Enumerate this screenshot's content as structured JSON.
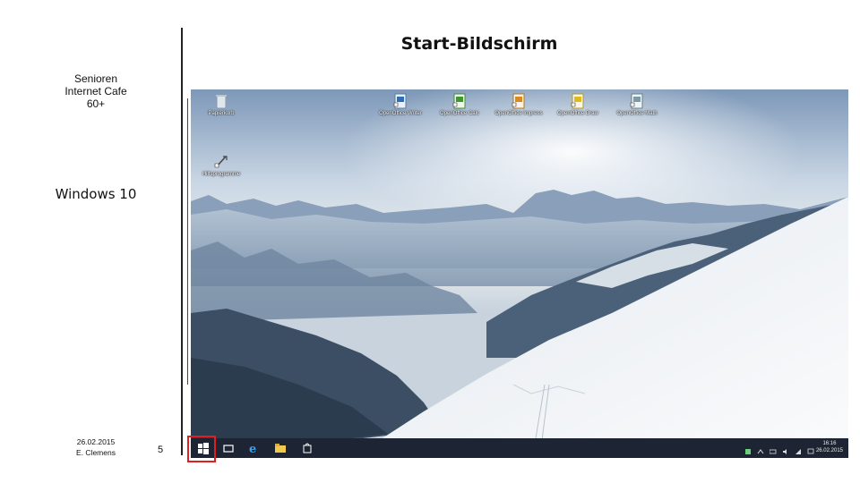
{
  "slide": {
    "title": "Start-Bildschirm",
    "org_lines": [
      "Senioren",
      "Internet Cafe",
      "60+"
    ],
    "subject": "Windows 10",
    "date": "26.02.2015",
    "author": "E. Clemens",
    "page": "5"
  },
  "desktop": {
    "icons": [
      {
        "label": "Papierkorb",
        "icon": "recycle-bin-icon"
      },
      {
        "label": "OpenOffice Writer",
        "icon": "openoffice-writer-icon"
      },
      {
        "label": "OpenOffice Calc",
        "icon": "openoffice-calc-icon"
      },
      {
        "label": "OpenOffice Impress",
        "icon": "openoffice-impress-icon"
      },
      {
        "label": "OpenOffice Draw",
        "icon": "openoffice-draw-icon"
      },
      {
        "label": "OpenOffice Math",
        "icon": "openoffice-math-icon"
      },
      {
        "label": "Hilfsprogramme",
        "icon": "shortcut-icon"
      }
    ],
    "taskbar": {
      "items": [
        "start-button",
        "task-view",
        "internet-explorer",
        "file-explorer",
        "store"
      ],
      "clock": {
        "time": "16:16",
        "date": "26.02.2015"
      }
    }
  },
  "colors": {
    "taskbar": "#1d2433",
    "highlight": "#e02020",
    "sky": "#c9d6e4",
    "snow": "#f4f6f8"
  }
}
